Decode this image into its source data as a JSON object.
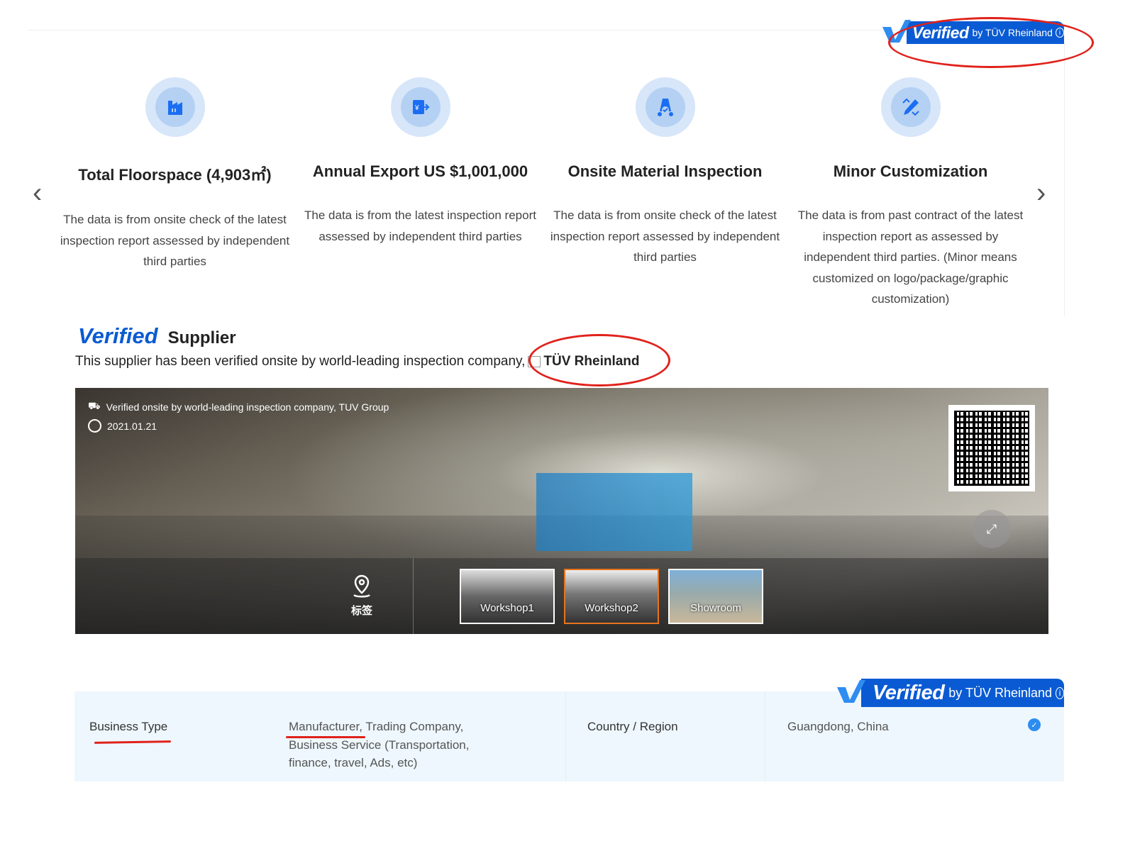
{
  "badge": {
    "verified": "Verified",
    "by": "by TÜV Rheinland"
  },
  "features": [
    {
      "icon": "factory-icon",
      "title": "Total Floorspace (4,903㎡)",
      "desc": "The data is from onsite check of the latest inspection report assessed by independent third parties"
    },
    {
      "icon": "export-icon",
      "title": "Annual Export US $1,001,000",
      "desc": "The data is from the latest inspection report assessed by independent third parties"
    },
    {
      "icon": "inspection-icon",
      "title": "Onsite Material Inspection",
      "desc": "The data is from onsite check of the latest inspection report assessed by independent third parties"
    },
    {
      "icon": "customization-icon",
      "title": "Minor Customization",
      "desc": "The data is from past contract of the latest inspection report as assessed by independent third parties.   (Minor means customized on logo/package/graphic customization)"
    }
  ],
  "supplier": {
    "verified": "Verified",
    "title": "Supplier",
    "desc": "This supplier has been verified onsite by world-leading inspection company,",
    "company": "TÜV Rheinland"
  },
  "panorama": {
    "verified_text": "Verified onsite by world-leading inspection company, TUV Group",
    "date": "2021.01.21",
    "tag_label": "标签",
    "scenes": [
      {
        "label": "Workshop1",
        "active": false
      },
      {
        "label": "Workshop2",
        "active": true
      },
      {
        "label": "Showroom",
        "active": false
      }
    ]
  },
  "info": {
    "business_type_label": "Business Type",
    "business_type_value": "Manufacturer, Trading Company, Business Service (Transportation, finance, travel, Ads, etc)",
    "country_label": "Country / Region",
    "country_value": "Guangdong, China"
  },
  "colors": {
    "brand": "#0a5bd3",
    "annotation": "#e0221b",
    "active_scene": "#e8741e"
  }
}
